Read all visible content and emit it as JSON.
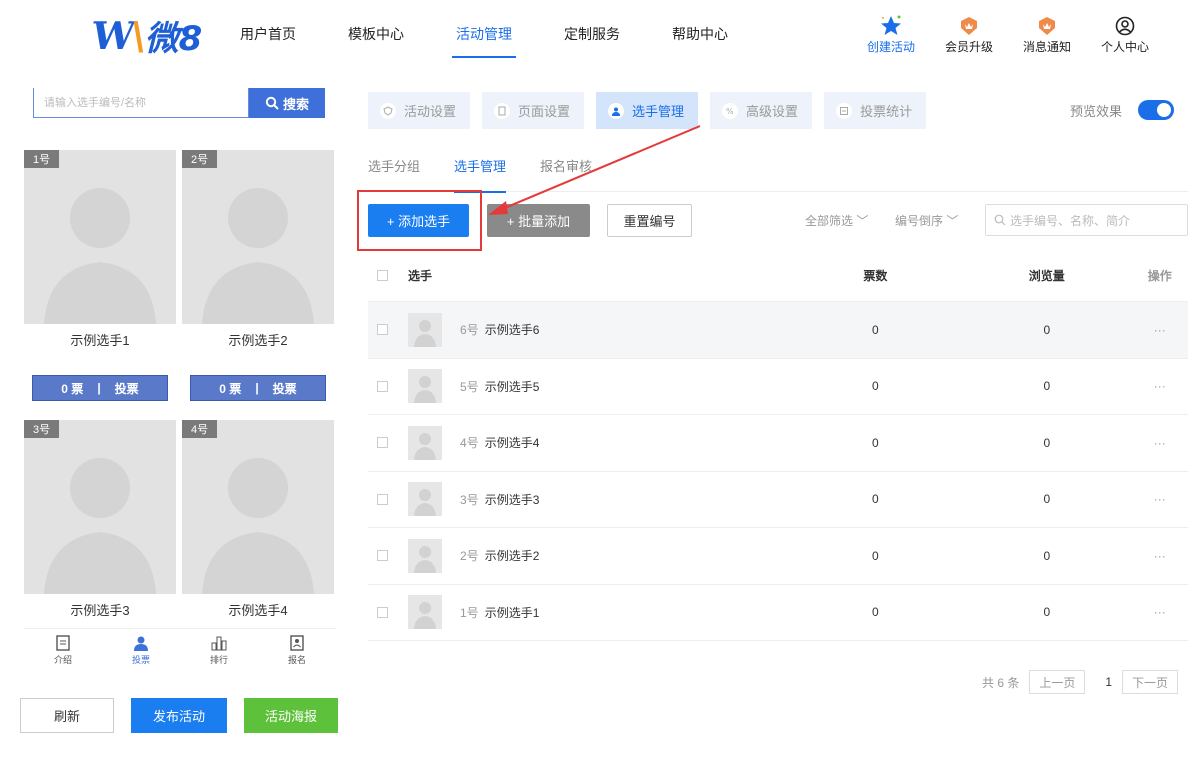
{
  "brand": {
    "logo_text": "微8"
  },
  "nav": {
    "items": [
      "用户首页",
      "模板中心",
      "活动管理",
      "定制服务",
      "帮助中心"
    ],
    "active": "活动管理",
    "right": [
      "创建活动",
      "会员升级",
      "消息通知",
      "个人中心"
    ]
  },
  "preview": {
    "search_placeholder": "请输入选手编号/名称",
    "search_button": "搜索",
    "contestants": [
      {
        "tag": "1号",
        "name": "示例选手1",
        "votes": "0 票",
        "vote_btn": "投票"
      },
      {
        "tag": "2号",
        "name": "示例选手2",
        "votes": "0 票",
        "vote_btn": "投票"
      },
      {
        "tag": "3号",
        "name": "示例选手3"
      },
      {
        "tag": "4号",
        "name": "示例选手4"
      }
    ],
    "tabs": [
      "介绍",
      "投票",
      "排行",
      "报名"
    ],
    "active_tab": "投票"
  },
  "left_actions": {
    "refresh": "刷新",
    "publish": "发布活动",
    "poster": "活动海报"
  },
  "steps": [
    "活动设置",
    "页面设置",
    "选手管理",
    "高级设置",
    "投票统计"
  ],
  "active_step": "选手管理",
  "preview_toggle": {
    "label": "预览效果",
    "on": true
  },
  "subtabs": [
    "选手分组",
    "选手管理",
    "报名审核"
  ],
  "active_subtab": "选手管理",
  "toolbar": {
    "add": "+ 添加选手",
    "batch": "+ 批量添加",
    "renumber": "重置编号",
    "filter_all": "全部筛选 ﹀",
    "sort": "编号倒序 ﹀",
    "search_placeholder": "选手编号、名称、简介"
  },
  "table": {
    "headers": {
      "name": "选手",
      "votes": "票数",
      "views": "浏览量",
      "op": "操作"
    },
    "rows": [
      {
        "num": "6号",
        "name": "示例选手6",
        "votes": "0",
        "views": "0",
        "op": "···"
      },
      {
        "num": "5号",
        "name": "示例选手5",
        "votes": "0",
        "views": "0",
        "op": "···"
      },
      {
        "num": "4号",
        "name": "示例选手4",
        "votes": "0",
        "views": "0",
        "op": "···"
      },
      {
        "num": "3号",
        "name": "示例选手3",
        "votes": "0",
        "views": "0",
        "op": "···"
      },
      {
        "num": "2号",
        "name": "示例选手2",
        "votes": "0",
        "views": "0",
        "op": "···"
      },
      {
        "num": "1号",
        "name": "示例选手1",
        "votes": "0",
        "views": "0",
        "op": "···"
      }
    ]
  },
  "pager": {
    "total": "共 6 条",
    "prev": "上一页",
    "page": "1",
    "next": "下一页"
  },
  "colors": {
    "primary": "#1a7ef0",
    "highlight": "#e53a3a",
    "green": "#5ec13b"
  }
}
